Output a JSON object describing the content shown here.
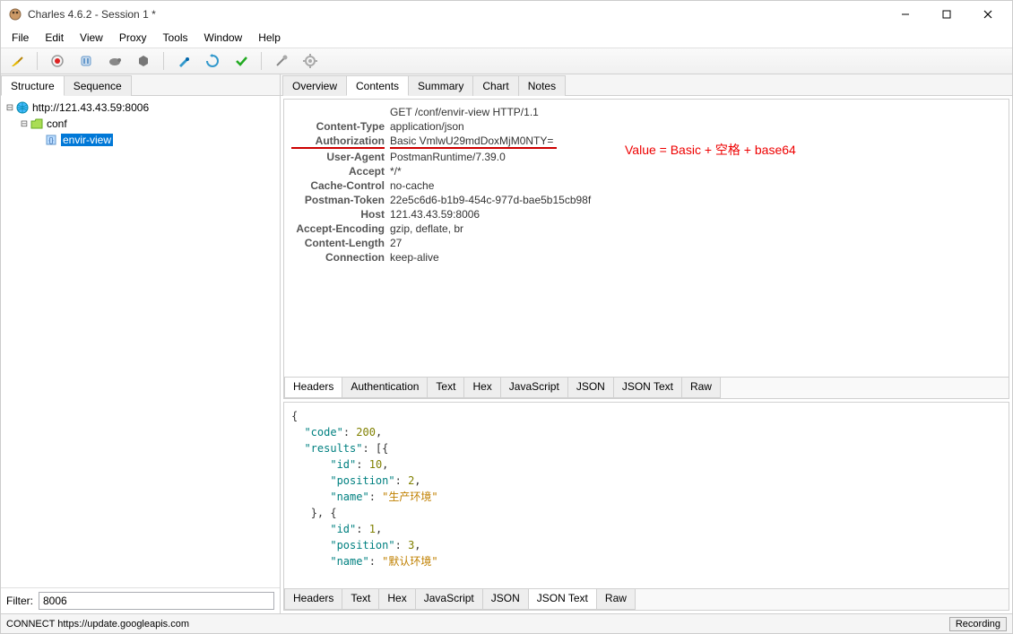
{
  "window": {
    "title": "Charles 4.6.2 - Session 1 *"
  },
  "menu": [
    "File",
    "Edit",
    "View",
    "Proxy",
    "Tools",
    "Window",
    "Help"
  ],
  "left_tabs": [
    {
      "label": "Structure",
      "active": true
    },
    {
      "label": "Sequence",
      "active": false
    }
  ],
  "tree": {
    "root": "http://121.43.43.59:8006",
    "folder": "conf",
    "leaf": "envir-view"
  },
  "filter": {
    "label": "Filter:",
    "value": "8006"
  },
  "detail_tabs": [
    "Overview",
    "Contents",
    "Summary",
    "Chart",
    "Notes"
  ],
  "detail_active": "Contents",
  "request": {
    "first_line": "GET /conf/envir-view HTTP/1.1",
    "headers": [
      {
        "k": "Content-Type",
        "v": "application/json"
      },
      {
        "k": "Authorization",
        "v": "Basic VmlwU29mdDoxMjM0NTY=",
        "hl": true
      },
      {
        "k": "User-Agent",
        "v": "PostmanRuntime/7.39.0"
      },
      {
        "k": "Accept",
        "v": "*/*"
      },
      {
        "k": "Cache-Control",
        "v": "no-cache"
      },
      {
        "k": "Postman-Token",
        "v": "22e5c6d6-b1b9-454c-977d-bae5b15cb98f"
      },
      {
        "k": "Host",
        "v": "121.43.43.59:8006"
      },
      {
        "k": "Accept-Encoding",
        "v": "gzip, deflate, br"
      },
      {
        "k": "Content-Length",
        "v": "27"
      },
      {
        "k": "Connection",
        "v": "keep-alive"
      }
    ]
  },
  "annotation": "Value =   Basic + 空格 + base64",
  "req_subtabs": [
    "Headers",
    "Authentication",
    "Text",
    "Hex",
    "JavaScript",
    "JSON",
    "JSON Text",
    "Raw"
  ],
  "req_subtab_active": "Headers",
  "response_json": {
    "code": 200,
    "results": [
      {
        "id": 10,
        "position": 2,
        "name": "生产环境"
      },
      {
        "id": 1,
        "position": 3,
        "name": "默认环境"
      }
    ]
  },
  "resp_subtabs": [
    "Headers",
    "Text",
    "Hex",
    "JavaScript",
    "JSON",
    "JSON Text",
    "Raw"
  ],
  "resp_subtab_active": "JSON Text",
  "status": {
    "left": "CONNECT https://update.googleapis.com",
    "right": "Recording"
  }
}
